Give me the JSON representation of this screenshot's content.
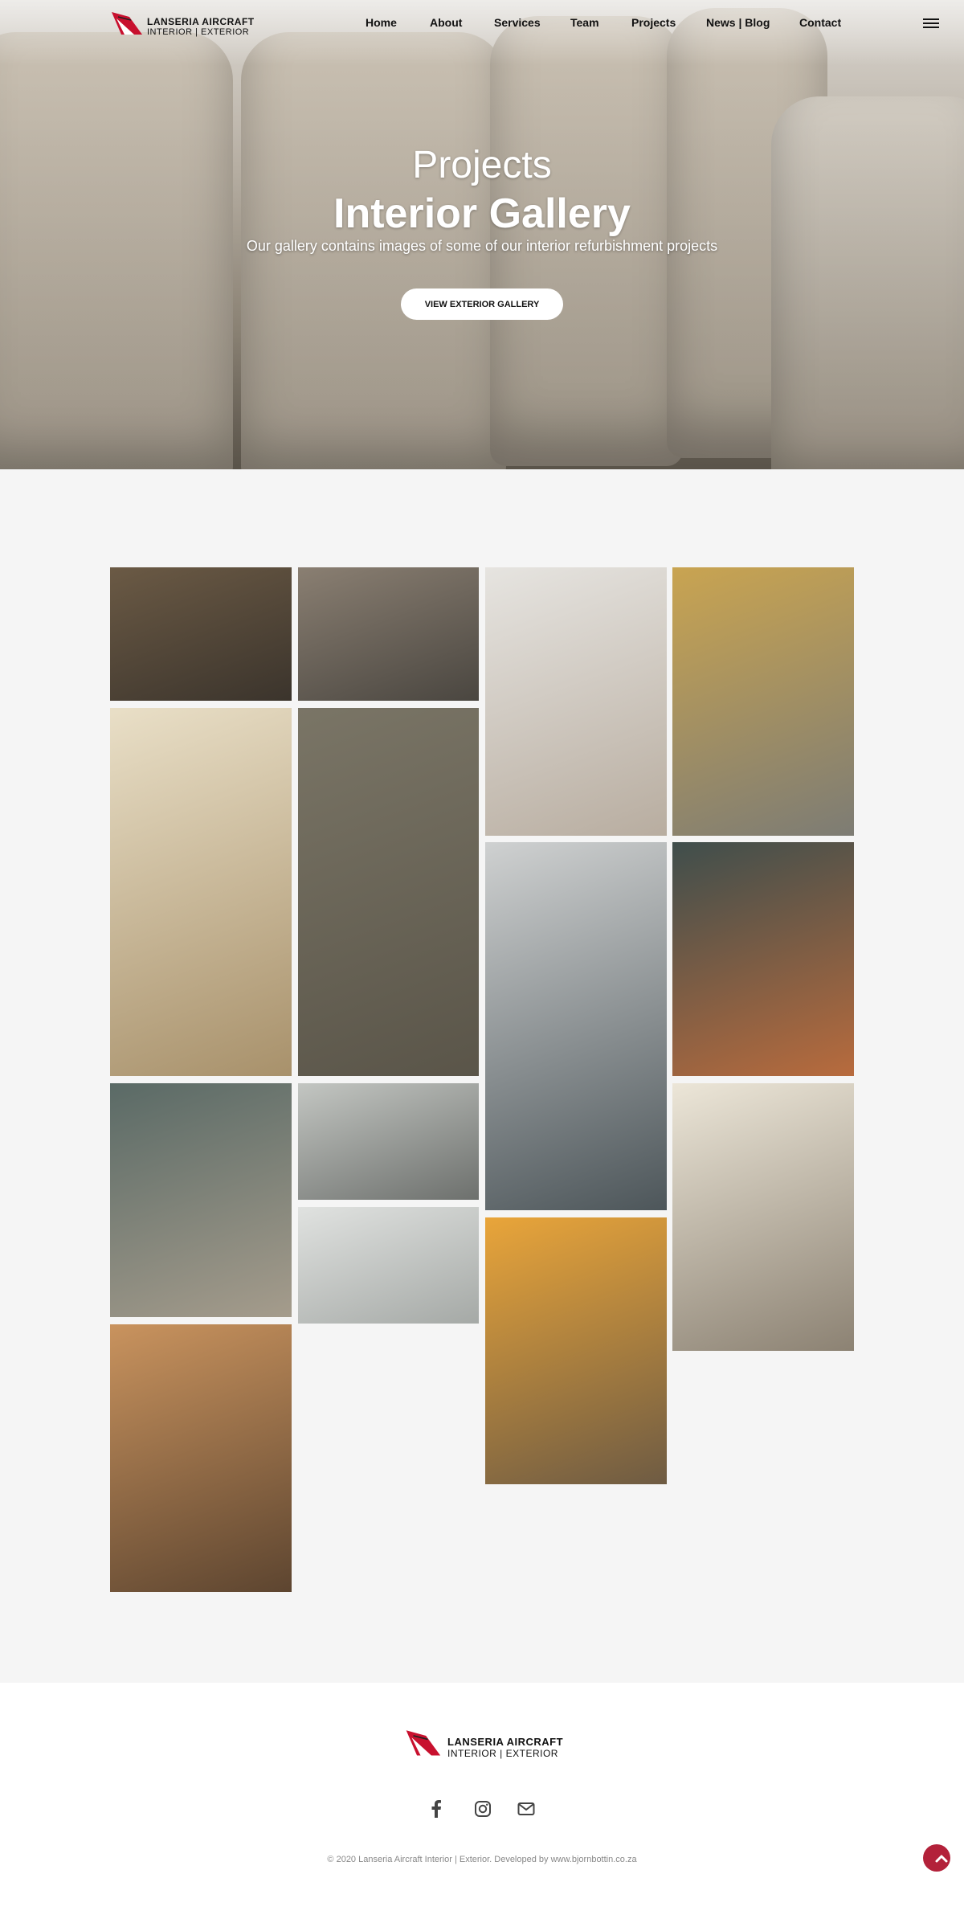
{
  "brand": {
    "name_line1": "LANSERIA AIRCRAFT",
    "name_line2": "INTERIOR | EXTERIOR",
    "accent": "#c8102e"
  },
  "nav": {
    "items": [
      {
        "label": "Home"
      },
      {
        "label": "About"
      },
      {
        "label": "Services"
      },
      {
        "label": "Team"
      },
      {
        "label": "Projects"
      },
      {
        "label": "News | Blog"
      },
      {
        "label": "Contact"
      }
    ],
    "menu_icon": "hamburger-icon"
  },
  "hero": {
    "subtitle": "Projects",
    "title": "Interior Gallery",
    "description": "Our gallery contains images of some of our interior refurbishment projects",
    "button_label": "VIEW EXTERIOR GALLERY"
  },
  "gallery": {
    "items": [
      {
        "subject": "cockpit-panel",
        "colors": [
          "#6b5a45",
          "#3b342c"
        ]
      },
      {
        "subject": "stripped-cabin",
        "colors": [
          "#8a7f72",
          "#4a4640"
        ]
      },
      {
        "subject": "cabin-ceiling",
        "colors": [
          "#e6e4e0",
          "#b8ada0"
        ]
      },
      {
        "subject": "fuselage-structure",
        "colors": [
          "#c9a451",
          "#7d7c74"
        ]
      },
      {
        "subject": "beige-seat-cabin",
        "colors": [
          "#e9dfc7",
          "#a8916b"
        ]
      },
      {
        "subject": "cockpit-rebuild",
        "colors": [
          "#7a7566",
          "#5a5549"
        ]
      },
      {
        "subject": "grey-seat-floor",
        "colors": [
          "#cfd1d1",
          "#4d565a"
        ]
      },
      {
        "subject": "seat-frame-hangar",
        "colors": [
          "#3f4e4c",
          "#b86b3d"
        ]
      },
      {
        "subject": "worn-seat",
        "colors": [
          "#5a6a66",
          "#a59c8c"
        ]
      },
      {
        "subject": "cockpit-seats",
        "colors": [
          "#c3c6c2",
          "#6d706d"
        ]
      },
      {
        "subject": "leather-seat-pair",
        "colors": [
          "#e0e2e0",
          "#a5a9a6"
        ]
      },
      {
        "subject": "orange-foam-seats",
        "colors": [
          "#e9a53a",
          "#6e5b43"
        ]
      },
      {
        "subject": "cream-seat-cabin",
        "colors": [
          "#ece6d8",
          "#8c8273"
        ]
      },
      {
        "subject": "tan-leather-seat",
        "colors": [
          "#c9935e",
          "#5d4530"
        ]
      }
    ]
  },
  "footer": {
    "social": [
      {
        "icon": "facebook-icon",
        "glyph": "f"
      },
      {
        "icon": "instagram-icon",
        "glyph": "◎"
      },
      {
        "icon": "email-icon",
        "glyph": "✉"
      }
    ],
    "copyright": "© 2020 Lanseria Aircraft Interior | Exterior. Developed by www.bjornbottin.co.za",
    "to_top_icon": "chevron-up-icon"
  }
}
